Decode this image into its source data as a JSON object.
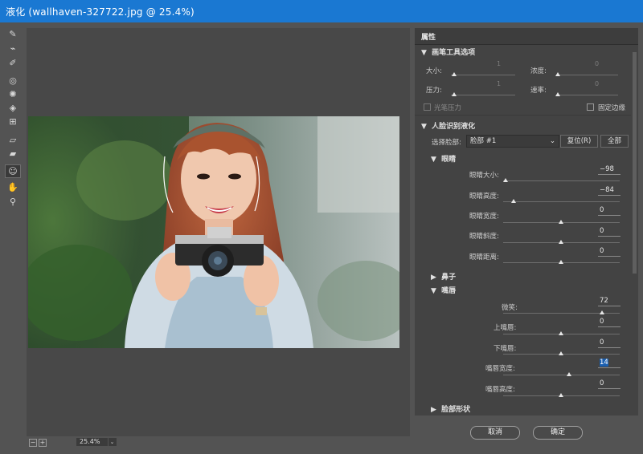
{
  "window": {
    "title": "液化 (wallhaven-327722.jpg @ 25.4%)"
  },
  "tools": [
    {
      "name": "forward-warp-icon",
      "glyph": "✎"
    },
    {
      "name": "reconstruct-icon",
      "glyph": "⌁"
    },
    {
      "name": "smooth-icon",
      "glyph": "✐"
    },
    {
      "name": "twirl-icon",
      "glyph": "◎"
    },
    {
      "name": "pucker-icon",
      "glyph": "✺"
    },
    {
      "name": "bloat-icon",
      "glyph": "◈"
    },
    {
      "name": "push-left-icon",
      "glyph": "⊞"
    },
    {
      "name": "freeze-mask-icon",
      "glyph": "▱"
    },
    {
      "name": "thaw-mask-icon",
      "glyph": "▰"
    },
    {
      "name": "face-tool-icon",
      "glyph": "☺"
    },
    {
      "name": "hand-icon",
      "glyph": "✋"
    },
    {
      "name": "zoom-icon",
      "glyph": "⚲"
    }
  ],
  "status": {
    "zoom": "25.4%",
    "minus": "−",
    "plus": "+",
    "dropdown": "⌄"
  },
  "panel": {
    "title": "属性",
    "brush": {
      "title": "画笔工具选项",
      "size_label": "大小:",
      "size_value": "1",
      "density_label": "浓度:",
      "density_value": "0",
      "pressure_label": "压力:",
      "pressure_value": "1",
      "rate_label": "速率:",
      "rate_value": "0",
      "stylus_label": "光笔压力",
      "pin_edges_label": "固定边缘"
    },
    "face": {
      "title": "人脸识别液化",
      "select_label": "选择脸部:",
      "select_value": "脸部 #1",
      "reset_label": "复位(R)",
      "all_label": "全部",
      "eyes": {
        "title": "眼睛",
        "rows": [
          {
            "label": "眼睛大小:",
            "value": "−98"
          },
          {
            "label": "眼睛高度:",
            "value": "−84"
          },
          {
            "label": "眼睛宽度:",
            "value": "0"
          },
          {
            "label": "眼睛斜度:",
            "value": "0"
          },
          {
            "label": "眼睛距离:",
            "value": "0"
          }
        ]
      },
      "nose": {
        "title": "鼻子"
      },
      "mouth": {
        "title": "嘴唇",
        "rows": [
          {
            "label": "微笑:",
            "value": "72"
          },
          {
            "label": "上嘴唇:",
            "value": "0"
          },
          {
            "label": "下嘴唇:",
            "value": "0"
          },
          {
            "label": "嘴唇宽度:",
            "value": "14"
          },
          {
            "label": "嘴唇高度:",
            "value": "0"
          }
        ]
      },
      "face_shape": {
        "title": "脸部形状"
      }
    }
  },
  "buttons": {
    "cancel": "取消",
    "ok": "确定"
  }
}
